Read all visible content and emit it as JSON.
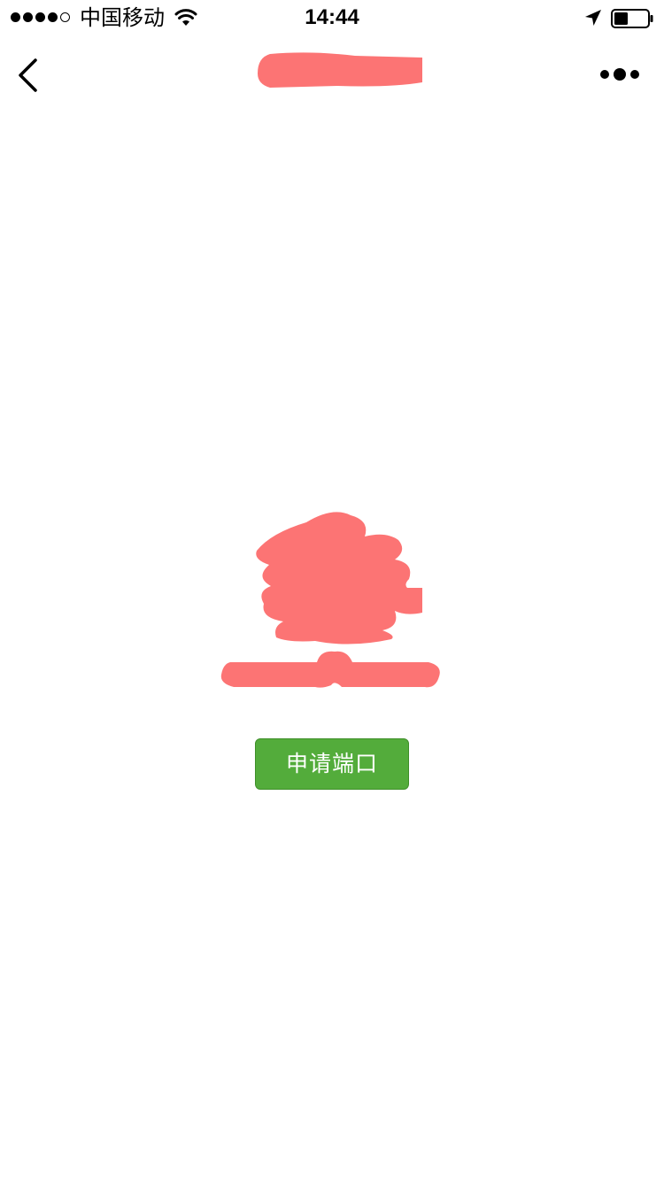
{
  "status_bar": {
    "carrier": "中国移动",
    "time": "14:44",
    "signal_strength": 4,
    "signal_max": 5,
    "battery_level": 0.4,
    "icons": [
      "wifi-icon",
      "location-arrow-icon",
      "battery-icon"
    ]
  },
  "nav": {
    "title": "",
    "back_icon": "chevron-left-icon",
    "more_icon": "more-dots-icon"
  },
  "main": {
    "apply_button_label": "申请端口"
  },
  "colors": {
    "primary_button": "#53ac3b",
    "redaction": "#fc7474"
  }
}
